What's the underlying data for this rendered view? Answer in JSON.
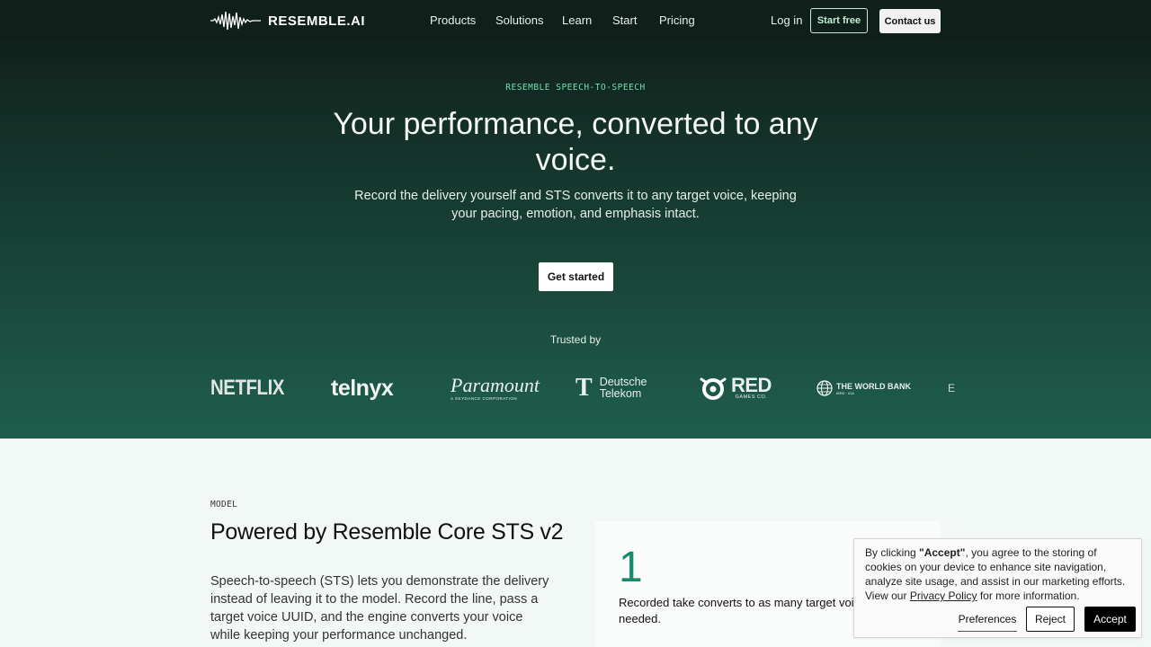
{
  "nav": {
    "logo_text": "RESEMBLE.AI",
    "links": [
      "Products",
      "Solutions",
      "Learn",
      "Start",
      "Pricing"
    ],
    "login": "Log in",
    "start_free": "Start free",
    "contact": "Contact us"
  },
  "hero": {
    "eyebrow": "RESEMBLE SPEECH-TO-SPEECH",
    "title": "Your performance, converted to any voice.",
    "subtitle": "Record the delivery yourself and STS converts it to any target voice, keeping your pacing, emotion, and emphasis intact.",
    "cta": "Get started",
    "trusted_label": "Trusted by",
    "brands": {
      "netflix": "NETFLIX",
      "telnyx": "telnyx",
      "paramount": "Paramount",
      "paramount_sub": "A SKYDANCE CORPORATION",
      "telekom_mark": "T",
      "telekom_line1": "Deutsche",
      "telekom_line2": "Telekom",
      "red": "RED",
      "red_sub": "GAMES CO.",
      "worldbank": "THE WORLD BANK",
      "worldbank_sub": "IBRD · IDA",
      "partial": "E"
    }
  },
  "model": {
    "eyebrow": "MODEL",
    "title": "Powered by Resemble Core STS v2",
    "body": "Speech-to-speech (STS) lets you demonstrate the delivery instead of leaving it to the model. Record the line, pass a target voice UUID, and the engine converts your voice while keeping your performance unchanged.",
    "card": {
      "number": "1",
      "text": "Recorded take converts to as many target voices as needed."
    }
  },
  "cookie": {
    "text_prefix": "By clicking ",
    "text_accept_word": "\"Accept\"",
    "text_middle": ", you agree to the storing of cookies on your device to enhance site navigation, analyze site usage, and assist in our marketing efforts. View our ",
    "privacy_link": "Privacy Policy",
    "text_suffix": " for more information.",
    "preferences": "Preferences",
    "reject": "Reject",
    "accept": "Accept"
  },
  "colors": {
    "nav_bg": "#0f1f1a",
    "hero_top": "#10221c",
    "hero_bottom": "#1f5e4c",
    "accent_green": "#6fe0b0",
    "page_bg": "#f1f8f5"
  },
  "icons": [
    "waveform-logo-icon",
    "world-bank-globe-icon",
    "red-games-mark-icon"
  ]
}
